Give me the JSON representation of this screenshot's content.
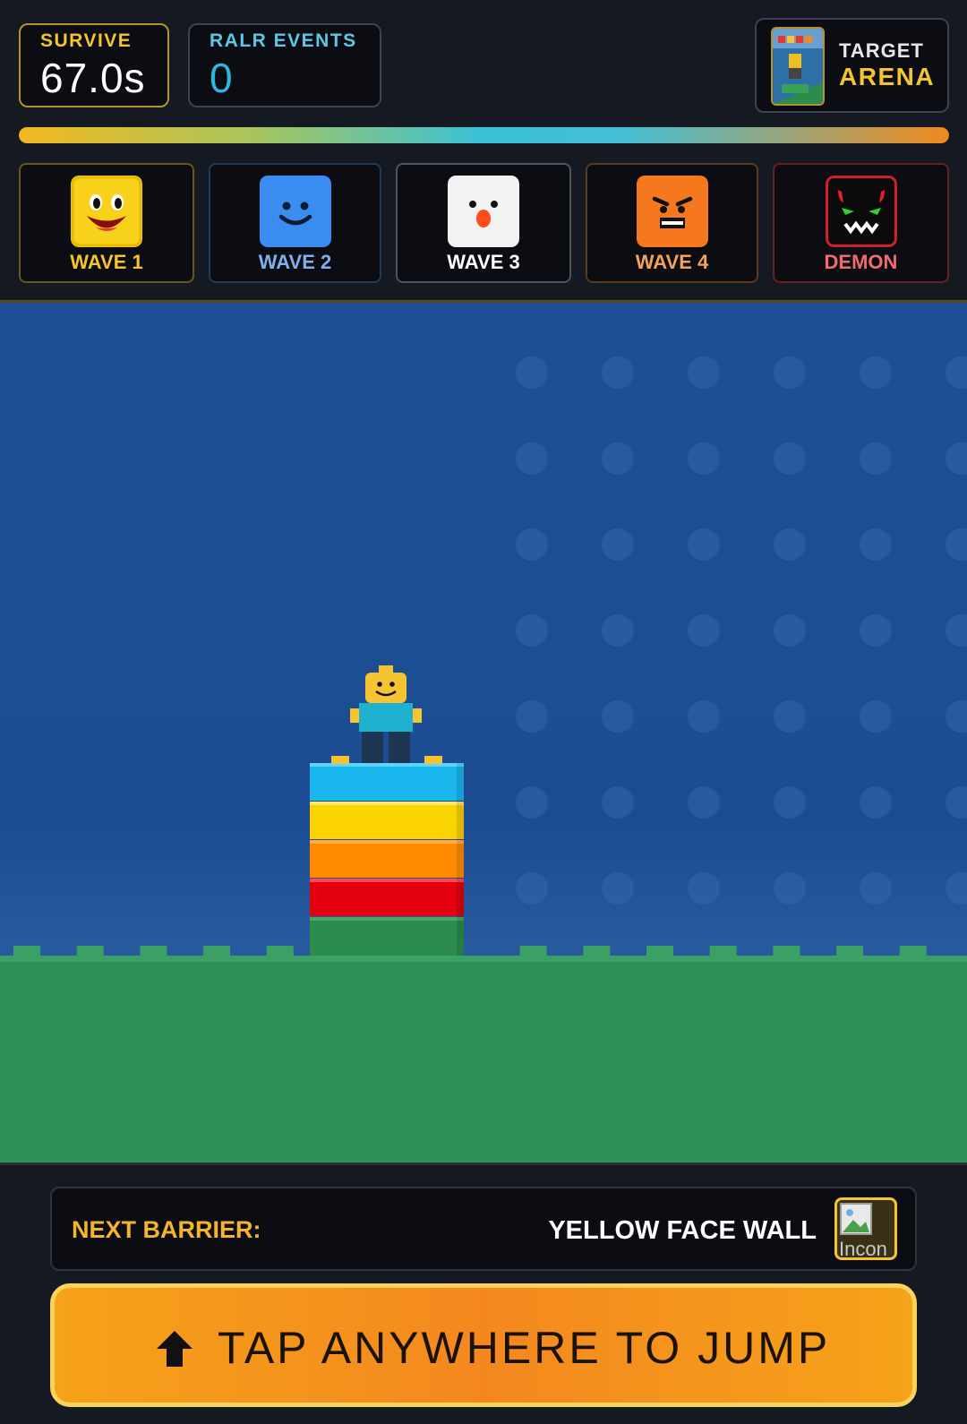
{
  "hud": {
    "survive": {
      "label": "SURVIVE",
      "value": "67.0s"
    },
    "events": {
      "label": "RALR EVENTS",
      "value": "0"
    },
    "target": {
      "label": "TARGET",
      "value": "ARENA"
    },
    "progress": 1.0
  },
  "waves": [
    {
      "label": "WAVE 1",
      "icon": "yellow-smile-face-icon"
    },
    {
      "label": "WAVE 2",
      "icon": "blue-smile-face-icon"
    },
    {
      "label": "WAVE 3",
      "icon": "white-clown-face-icon"
    },
    {
      "label": "WAVE 4",
      "icon": "orange-angry-face-icon"
    },
    {
      "label": "DEMON",
      "icon": "demon-face-icon"
    }
  ],
  "arena": {
    "tower_colors": [
      "#19b7ee",
      "#fbd300",
      "#ff8c00",
      "#e3000f",
      "#2b8c4e"
    ],
    "sky_color": "#1e4f95",
    "ground_color": "#2f8f58"
  },
  "footer": {
    "next_barrier_label": "NEXT BARRIER:",
    "next_barrier_value": "YELLOW FACE WALL",
    "barrier_icon_alt": "Incon",
    "jump_label": "TAP ANYWHERE TO JUMP"
  }
}
